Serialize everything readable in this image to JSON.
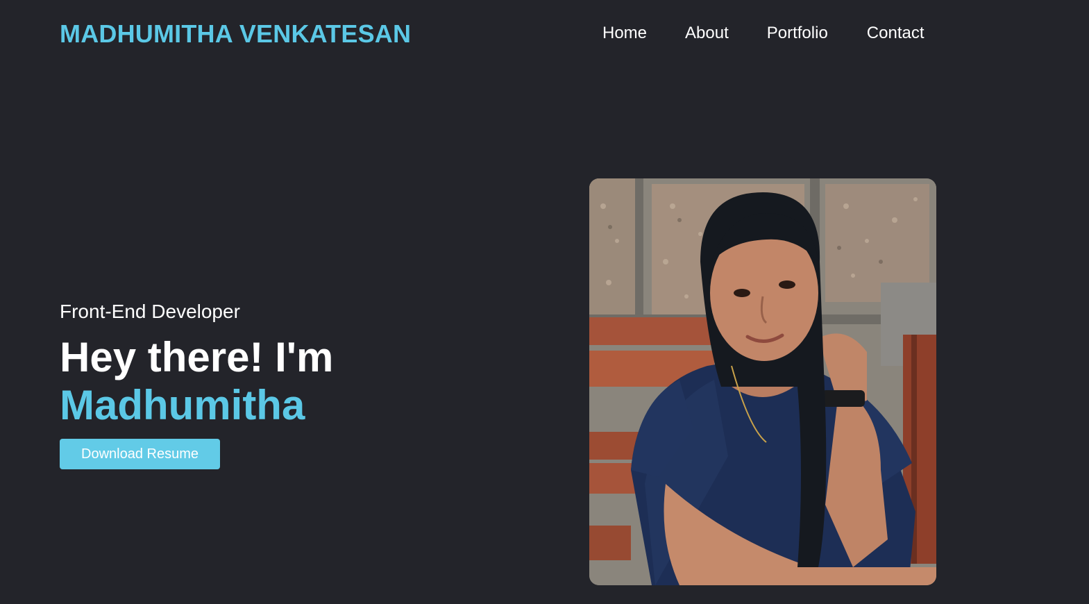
{
  "header": {
    "brand": "MADHUMITHA VENKATESAN",
    "nav": {
      "home": "Home",
      "about": "About",
      "portfolio": "Portfolio",
      "contact": "Contact"
    }
  },
  "hero": {
    "role": "Front-End Developer",
    "greeting": "Hey there! I'm",
    "name": "Madhumitha",
    "resume_button": "Download Resume"
  },
  "colors": {
    "background": "#23242a",
    "accent": "#5bc8e6",
    "text": "#ffffff"
  },
  "icons": {
    "photo": "profile-photo"
  }
}
